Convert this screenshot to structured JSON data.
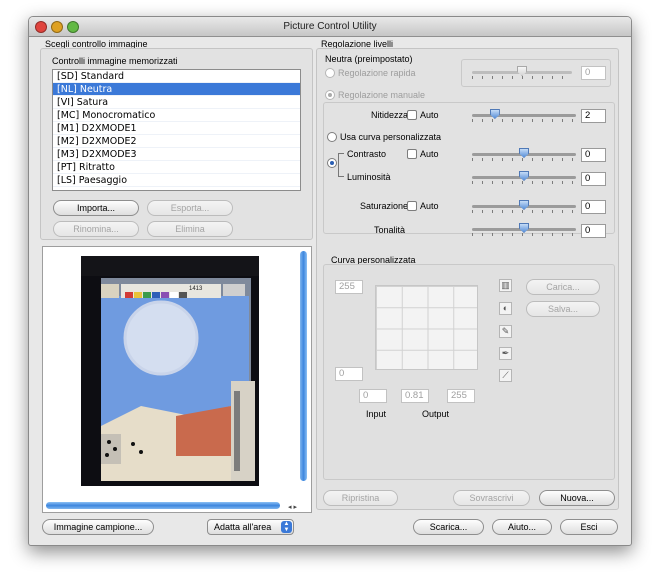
{
  "window": {
    "title": "Picture Control Utility"
  },
  "left": {
    "section_title": "Scegli controllo immagine",
    "list_title": "Controlli immagine memorizzati",
    "items": [
      "[SD] Standard",
      "[NL] Neutra",
      "[VI] Satura",
      "[MC] Monocromatico",
      "[M1] D2XMODE1",
      "[M2] D2XMODE2",
      "[M3] D2XMODE3",
      "[PT] Ritratto",
      "[LS] Paesaggio"
    ],
    "selected_index": 1,
    "buttons": {
      "import": "Importa...",
      "export": "Esporta...",
      "rename": "Rinomina...",
      "delete": "Elimina"
    },
    "preview": {
      "ruler_label": "1413"
    }
  },
  "right": {
    "section_title": "Regolazione livelli",
    "preset_name": "Neutra (preimpostato)",
    "quick_adjust_label": "Regolazione rapida",
    "quick_adjust_value": "0",
    "manual_label": "Regolazione manuale",
    "sharpness": {
      "label": "Nitidezza",
      "auto": "Auto",
      "value": "2"
    },
    "custom_curve_radio": "Usa curva personalizzata",
    "contrast": {
      "label": "Contrasto",
      "auto": "Auto",
      "value": "0"
    },
    "brightness": {
      "label": "Luminosità",
      "value": "0"
    },
    "saturation": {
      "label": "Saturazione",
      "auto": "Auto",
      "value": "0"
    },
    "hue": {
      "label": "Tonalità",
      "value": "0"
    },
    "curve": {
      "title": "Curva personalizzata",
      "out_max": "255",
      "out_min": "0",
      "input_value": "0",
      "gamma_value": "0.81",
      "output_value": "255",
      "input_label": "Input",
      "output_label": "Output",
      "load": "Carica...",
      "save": "Salva..."
    },
    "reset": "Ripristina",
    "overwrite": "Sovrascrivi",
    "new": "Nuova..."
  },
  "footer": {
    "sample_image": "Immagine campione...",
    "fit": "Adatta all'area",
    "download": "Scarica...",
    "help": "Aiuto...",
    "exit": "Esci"
  },
  "colors": {
    "selection": "#3b79d8",
    "slider_knob": "#5a90d8",
    "close": "#e0443e",
    "minimize": "#dea123",
    "zoom": "#62b944"
  }
}
